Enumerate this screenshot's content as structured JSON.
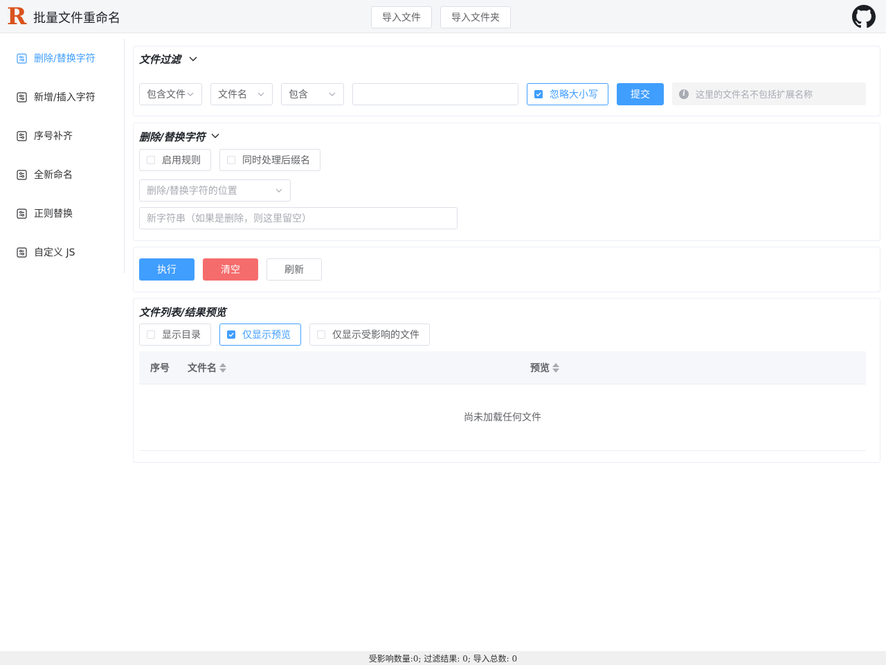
{
  "header": {
    "logo_letter": "R",
    "title": "批量文件重命名",
    "import_file": "导入文件",
    "import_folder": "导入文件夹",
    "github_icon": "github-icon"
  },
  "sidebar": {
    "items": [
      {
        "label": "删除/替换字符",
        "active": true
      },
      {
        "label": "新增/插入字符",
        "active": false
      },
      {
        "label": "序号补齐",
        "active": false
      },
      {
        "label": "全新命名",
        "active": false
      },
      {
        "label": "正则替换",
        "active": false
      },
      {
        "label": "自定义 JS",
        "active": false
      }
    ],
    "item_icon": "settings-panel-icon"
  },
  "filter": {
    "title": "文件过滤",
    "mode": "包含文件",
    "target": "文件名",
    "match": "包含",
    "value": "",
    "ignore_case": "忽略大小写",
    "ignore_case_checked": true,
    "submit": "提交",
    "tip": "这里的文件名不包括扩展名称"
  },
  "rule": {
    "title": "删除/替换字符",
    "enable": "启用规则",
    "enable_checked": false,
    "with_ext": "同时处理后缀名",
    "with_ext_checked": false,
    "position_placeholder": "删除/替换字符的位置",
    "new_string_placeholder": "新字符串（如果是删除，则这里留空）"
  },
  "actions": {
    "execute": "执行",
    "clear": "清空",
    "refresh": "刷新"
  },
  "list": {
    "title": "文件列表/结果预览",
    "show_dirs": "显示目录",
    "show_dirs_checked": false,
    "preview_only": "仅显示预览",
    "preview_only_checked": true,
    "affected_only": "仅显示受影响的文件",
    "affected_only_checked": false,
    "columns": [
      "序号",
      "文件名",
      "预览"
    ],
    "empty_text": "尚未加载任何文件"
  },
  "status": {
    "text": "受影响数量:0; 过滤结果: 0; 导入总数: 0"
  },
  "colors": {
    "primary": "#409eff",
    "danger": "#f56c6c",
    "logo": "#d9531e"
  }
}
